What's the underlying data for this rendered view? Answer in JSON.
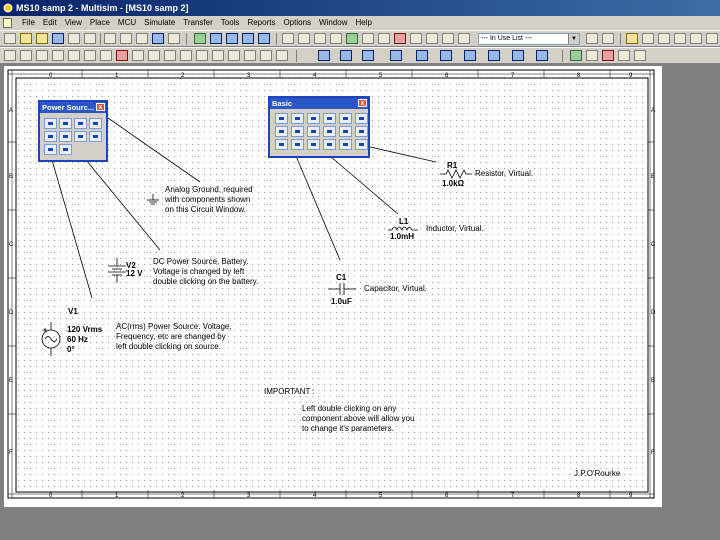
{
  "window": {
    "title": "MS10 samp 2 - Multisim - [MS10 samp 2]"
  },
  "menu": [
    "File",
    "Edit",
    "View",
    "Place",
    "MCU",
    "Simulate",
    "Transfer",
    "Tools",
    "Reports",
    "Options",
    "Window",
    "Help"
  ],
  "toolbar": {
    "in_use_list": "--- In Use List ---"
  },
  "ruler": {
    "columns": [
      "0",
      "1",
      "2",
      "3",
      "4",
      "5",
      "6",
      "7",
      "8",
      "9"
    ],
    "rows": [
      "A",
      "B",
      "C",
      "D",
      "E",
      "F"
    ]
  },
  "palettes": {
    "power": {
      "title": "Power Sourc...",
      "close": "x"
    },
    "basic": {
      "title": "Basic",
      "close": "x"
    }
  },
  "notes": {
    "ground": [
      "Analog Ground, required",
      "with components shown",
      "on this Circuit Window."
    ],
    "dc": [
      "DC Power Source, Battery.",
      "Voltage is changed by left",
      "double clicking on the battery."
    ],
    "ac": [
      "AC(rms) Power Source. Voltage,",
      "Frequency, etc are changed by",
      "left double clicking on source."
    ],
    "important": "IMPORTANT :",
    "important_body": [
      "Left double clicking on any",
      "component above will allow you",
      "to change it's parameters."
    ],
    "author": "J.P.O'Rourke"
  },
  "components": {
    "r1": {
      "ref": "R1",
      "value": "1.0kΩ",
      "desc": "Resistor, Virtual."
    },
    "l1": {
      "ref": "L1",
      "value": "1.0mH",
      "desc": "Inductor, Virtual."
    },
    "c1": {
      "ref": "C1",
      "value": "1.0uF",
      "desc": "Capacitor, Virtual."
    },
    "v2": {
      "ref": "V2",
      "value": "12 V"
    },
    "v1": {
      "ref": "V1",
      "value": "120 Vrms",
      "freq": "60 Hz",
      "phase": "0°"
    }
  }
}
